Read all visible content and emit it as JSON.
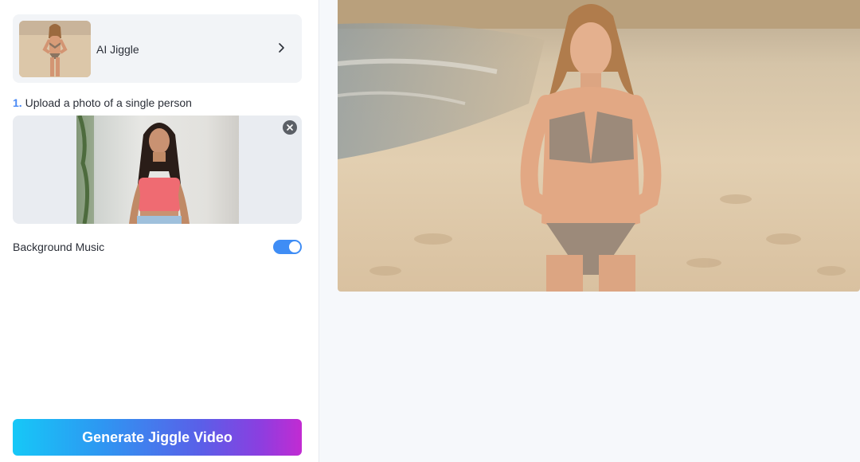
{
  "model": {
    "title": "AI Jiggle",
    "thumbnail_icon": "bikini-model-thumbnail",
    "chevron_icon": "chevron-right-icon"
  },
  "upload": {
    "step_number": "1.",
    "step_text": "Upload a photo of a single person",
    "photo_icon": "uploaded-person-photo",
    "remove_icon": "close-icon"
  },
  "settings": {
    "background_music_label": "Background Music",
    "background_music_on": true
  },
  "actions": {
    "generate_label": "Generate Jiggle Video"
  },
  "preview": {
    "image_icon": "beach-preview-image"
  },
  "colors": {
    "accent": "#3f8df5",
    "step_number": "#4a8af5",
    "button_gradient_start": "#16c8f7",
    "button_gradient_end": "#c22bd2"
  }
}
